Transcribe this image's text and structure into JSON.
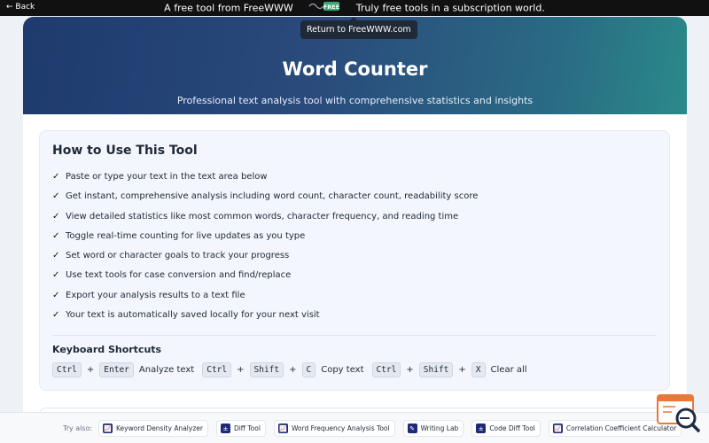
{
  "topbar": {
    "back_label": "← Back",
    "promo_before": "A free tool from FreeWWW",
    "promo_badge": "FREE",
    "promo_after": "Truly free tools in a subscription world.",
    "tooltip": "Return to FreeWWW.com"
  },
  "hero": {
    "title": "Word Counter",
    "subtitle": "Professional text analysis tool with comprehensive statistics and insights"
  },
  "howto": {
    "title": "How to Use This Tool",
    "check_glyph": "✓",
    "steps": [
      "Paste or type your text in the text area below",
      "Get instant, comprehensive analysis including word count, character count, readability score",
      "View detailed statistics like most common words, character frequency, and reading time",
      "Toggle real-time counting for live updates as you type",
      "Set word or character goals to track your progress",
      "Use text tools for case conversion and find/replace",
      "Export your analysis results to a text file",
      "Your text is automatically saved locally for your next visit"
    ],
    "shortcuts_title": "Keyboard Shortcuts",
    "plus": "+",
    "shortcuts": [
      {
        "keys": [
          "Ctrl",
          "Enter"
        ],
        "desc": "Analyze text"
      },
      {
        "keys": [
          "Ctrl",
          "Shift",
          "C"
        ],
        "desc": "Copy text"
      },
      {
        "keys": [
          "Ctrl",
          "Shift",
          "X"
        ],
        "desc": "Clear all"
      }
    ]
  },
  "tryalso": {
    "label": "Try also:",
    "tools": [
      {
        "label": "Keyword Density Analyzer",
        "icon": "chart-icon",
        "glyph": "📈"
      },
      {
        "label": "Diff Tool",
        "icon": "plus-minus-icon",
        "glyph": "±"
      },
      {
        "label": "Word Frequency Analysis Tool",
        "icon": "chart-icon",
        "glyph": "📈"
      },
      {
        "label": "Writing Lab",
        "icon": "pen-icon",
        "glyph": "✎"
      },
      {
        "label": "Code Diff Tool",
        "icon": "plus-minus-icon",
        "glyph": "±"
      },
      {
        "label": "Correlation Coefficient Calculator",
        "icon": "chart-icon",
        "glyph": "📈"
      }
    ]
  },
  "colors": {
    "topbar": "#111111",
    "hero_start": "#1e3a6e",
    "hero_end": "#2a8a8a",
    "badge": "#3aa872",
    "tool_icon": "#1e2a78",
    "float_icon_accent": "#e8793a",
    "float_icon_dark": "#1f2a44"
  }
}
